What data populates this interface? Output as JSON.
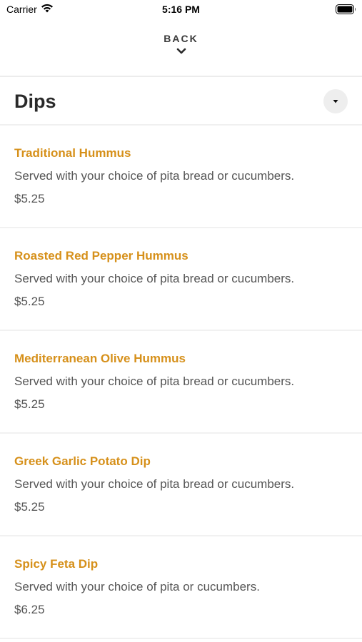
{
  "status_bar": {
    "carrier": "Carrier",
    "time": "5:16 PM",
    "wifi_icon": "wifi-icon",
    "battery_icon": "battery-icon"
  },
  "nav": {
    "back_label": "BACK",
    "back_icon": "chevron-down-icon"
  },
  "section": {
    "title": "Dips",
    "toggle_icon": "caret-down-icon"
  },
  "colors": {
    "accent": "#d6901a",
    "text": "#555555",
    "divider": "#f1f1f1"
  },
  "items": [
    {
      "name": "Traditional Hummus",
      "description": "Served with your choice of pita bread or cucumbers.",
      "price": "$5.25"
    },
    {
      "name": "Roasted Red Pepper Hummus",
      "description": "Served with your choice of pita bread or cucumbers.",
      "price": "$5.25"
    },
    {
      "name": "Mediterranean Olive Hummus",
      "description": "Served with your choice of pita bread or cucumbers.",
      "price": "$5.25"
    },
    {
      "name": "Greek Garlic Potato Dip",
      "description": "Served with your choice of pita bread or cucumbers.",
      "price": "$5.25"
    },
    {
      "name": "Spicy Feta Dip",
      "description": "Served with your choice of pita or cucumbers.",
      "price": "$6.25"
    }
  ]
}
